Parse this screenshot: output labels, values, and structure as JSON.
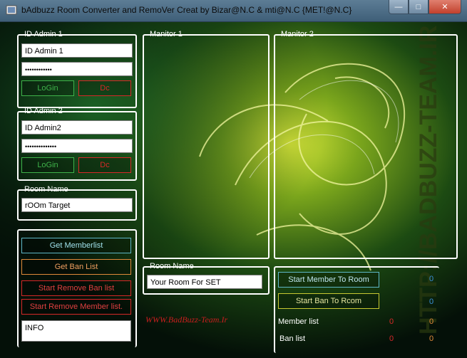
{
  "window": {
    "title": "bAdbuzz Room Converter and RemoVer Creat by Bizar@N.C & mti@N.C {MET!@N.C}"
  },
  "admin1": {
    "legend": "ID Admin 1",
    "id_value": "ID Admin 1",
    "password_value": "••••••••••••",
    "login_label": "LoGin",
    "dc_label": "Dc"
  },
  "admin2": {
    "legend": "ID Admin 2",
    "id_value": "ID Admin2",
    "password_value": "••••••••••••••",
    "login_label": "LoGin",
    "dc_label": "Dc"
  },
  "room_left": {
    "legend": "Room Name",
    "value": "rOOm Target"
  },
  "actions": {
    "get_memberlist": "Get Memberlist",
    "get_ban_list": "Get Ban List",
    "start_remove_ban": "Start Remove Ban list",
    "start_remove_member": "Start Remove Member list.",
    "info": "INFO"
  },
  "monitor1": {
    "legend": "Manitor 1"
  },
  "monitor2": {
    "legend": "Manitor 2"
  },
  "room_center": {
    "legend": "Room Name",
    "value": "Your Room For SET"
  },
  "watermark": {
    "site": "WWW.BadBuzz-Team.Ir"
  },
  "right_panel": {
    "start_member_label": "Start Member To Room",
    "start_member_count": "0",
    "start_ban_label": "Start Ban To Rcom",
    "start_ban_count": "0",
    "member_list_label": "Member list",
    "member_list_val1": "0",
    "member_list_val2": "0",
    "ban_list_label": "Ban list",
    "ban_list_val1": "0",
    "ban_list_val2": "0"
  },
  "colors": {
    "green": "#3fb34a",
    "red": "#d62828",
    "cyan": "#5fb8c8",
    "orange": "#e08a3a",
    "yellow": "#c8c832",
    "blue_num": "#3a8fd6"
  }
}
